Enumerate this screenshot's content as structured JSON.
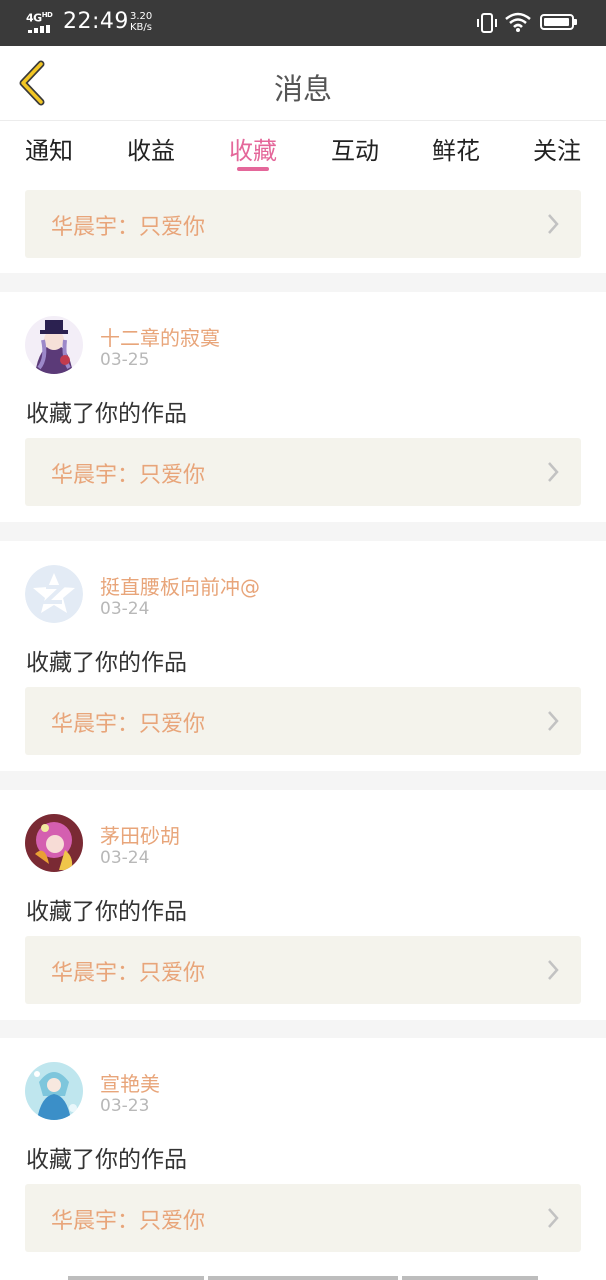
{
  "status_bar": {
    "network": "4G",
    "network_suffix": "HD",
    "time": "22:49",
    "speed_value": "3.20",
    "speed_unit": "KB/s"
  },
  "header": {
    "title": "消息",
    "back_icon": "chevron-left-icon"
  },
  "tabs": [
    {
      "label": "通知",
      "active": false
    },
    {
      "label": "收益",
      "active": false
    },
    {
      "label": "收藏",
      "active": true
    },
    {
      "label": "互动",
      "active": false
    },
    {
      "label": "鲜花",
      "active": false
    },
    {
      "label": "关注",
      "active": false
    }
  ],
  "colors": {
    "accent": "#e4679a",
    "name": "#e8a57a",
    "work_bg": "#f4f3ec",
    "page_bg": "#f5f5f5"
  },
  "first_card": {
    "work_title": "华晨宇：只爱你"
  },
  "messages": [
    {
      "username": "十二章的寂寞",
      "date": "03-25",
      "action": "收藏了你的作品",
      "work_title": "华晨宇：只爱你",
      "avatar": "anime-avatar-purple"
    },
    {
      "username": "挺直腰板向前冲@",
      "date": "03-24",
      "action": "收藏了你的作品",
      "work_title": "华晨宇：只爱你",
      "avatar": "default-avatar"
    },
    {
      "username": "茅田砂胡",
      "date": "03-24",
      "action": "收藏了你的作品",
      "work_title": "华晨宇：只爱你",
      "avatar": "anime-avatar-pink"
    },
    {
      "username": "宣艳美",
      "date": "03-23",
      "action": "收藏了你的作品",
      "work_title": "华晨宇：只爱你",
      "avatar": "anime-avatar-blue"
    }
  ]
}
